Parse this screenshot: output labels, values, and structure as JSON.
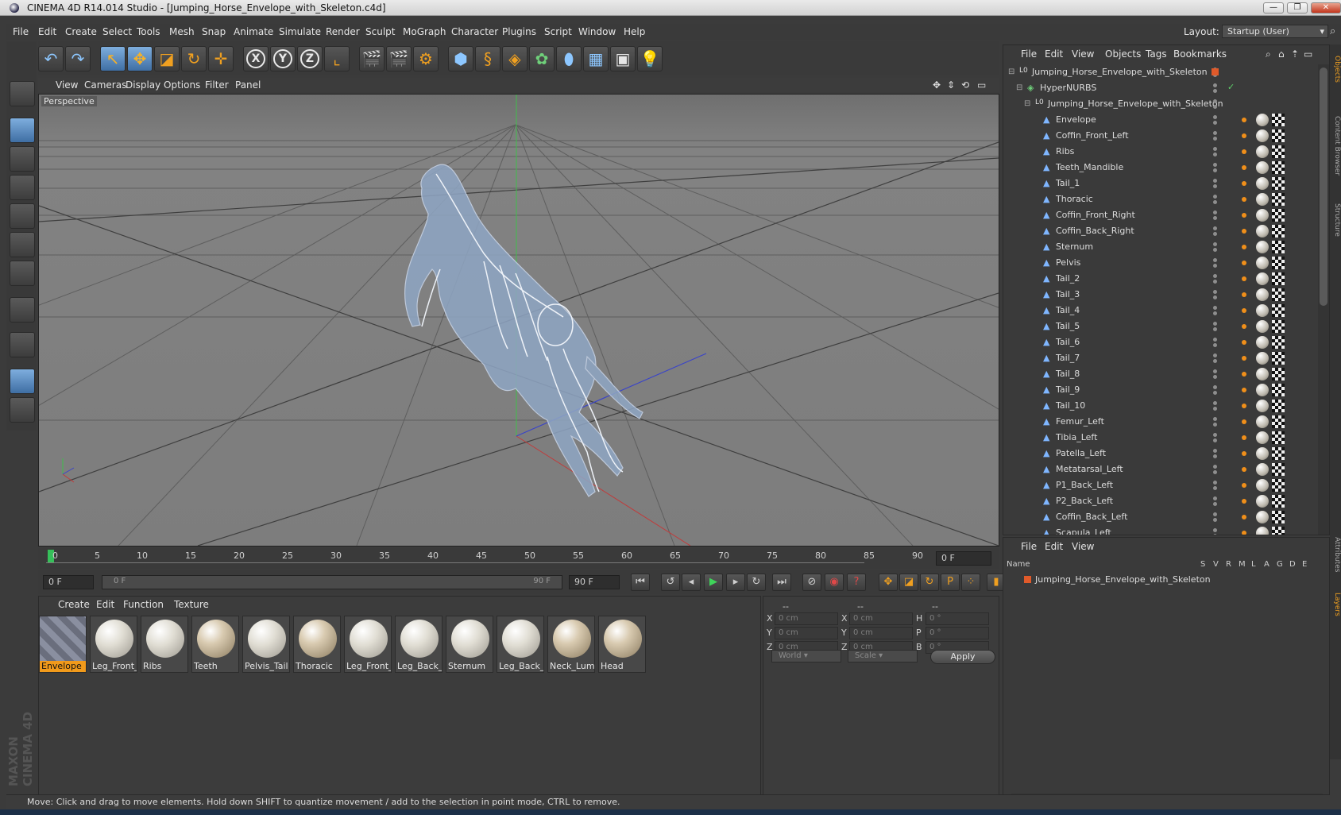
{
  "window": {
    "title": "CINEMA 4D R14.014 Studio - [Jumping_Horse_Envelope_with_Skeleton.c4d]",
    "min": "—",
    "max": "❐",
    "close": "✕"
  },
  "menubar": {
    "items": [
      "File",
      "Edit",
      "Create",
      "Select",
      "Tools",
      "Mesh",
      "Snap",
      "Animate",
      "Simulate",
      "Render",
      "Sculpt",
      "MoGraph",
      "Character",
      "Plugins",
      "Script",
      "Window",
      "Help"
    ],
    "layout_label": "Layout:",
    "layout_value": "Startup (User)"
  },
  "viewport": {
    "menu": [
      "View",
      "Cameras",
      "Display",
      "Options",
      "Filter",
      "Panel"
    ],
    "label": "Perspective"
  },
  "timeline": {
    "ticks": [
      "0",
      "5",
      "10",
      "15",
      "20",
      "25",
      "30",
      "35",
      "40",
      "45",
      "50",
      "55",
      "60",
      "65",
      "70",
      "75",
      "80",
      "85",
      "90"
    ],
    "current_frame": "0 F",
    "start_field": "0 F",
    "range_start": "0 F",
    "range_end": "90 F",
    "end_field": "90 F"
  },
  "materials": {
    "menu": [
      "Create",
      "Edit",
      "Function",
      "Texture"
    ],
    "items": [
      {
        "label": "Envelope",
        "kind": "hatch",
        "selected": true
      },
      {
        "label": "Leg_Front_",
        "kind": "plain"
      },
      {
        "label": "Ribs",
        "kind": "plain"
      },
      {
        "label": "Teeth",
        "kind": "speckle"
      },
      {
        "label": "Pelvis_Tail",
        "kind": "plain"
      },
      {
        "label": "Thoracic",
        "kind": "speckle"
      },
      {
        "label": "Leg_Front_",
        "kind": "plain"
      },
      {
        "label": "Leg_Back_F",
        "kind": "plain"
      },
      {
        "label": "Sternum",
        "kind": "plain"
      },
      {
        "label": "Leg_Back_L",
        "kind": "plain"
      },
      {
        "label": "Neck_Lumb",
        "kind": "speckle"
      },
      {
        "label": "Head",
        "kind": "speckle"
      }
    ]
  },
  "coords": {
    "header": [
      "--",
      "--",
      "--"
    ],
    "rows": [
      {
        "a": "X",
        "va": "0 cm",
        "b": "X",
        "vb": "0 cm",
        "c": "H",
        "vc": "0 °"
      },
      {
        "a": "Y",
        "va": "0 cm",
        "b": "Y",
        "vb": "0 cm",
        "c": "P",
        "vc": "0 °"
      },
      {
        "a": "Z",
        "va": "0 cm",
        "b": "Z",
        "vb": "0 cm",
        "c": "B",
        "vc": "0 °"
      }
    ],
    "space": "World",
    "mode": "Scale",
    "apply": "Apply"
  },
  "objects": {
    "menu": [
      "File",
      "Edit",
      "View",
      "Objects",
      "Tags",
      "Bookmarks"
    ],
    "tree": [
      {
        "name": "Jumping_Horse_Envelope_with_Skeleton",
        "level": 0,
        "kind": "null"
      },
      {
        "name": "HyperNURBS",
        "level": 1,
        "kind": "nurbs"
      },
      {
        "name": "Jumping_Horse_Envelope_with_Skeleton",
        "level": 2,
        "kind": "null"
      },
      {
        "name": "Envelope",
        "level": 3,
        "kind": "mesh"
      },
      {
        "name": "Coffin_Front_Left",
        "level": 3,
        "kind": "mesh"
      },
      {
        "name": "Ribs",
        "level": 3,
        "kind": "mesh"
      },
      {
        "name": "Teeth_Mandible",
        "level": 3,
        "kind": "mesh"
      },
      {
        "name": "Tail_1",
        "level": 3,
        "kind": "mesh"
      },
      {
        "name": "Thoracic",
        "level": 3,
        "kind": "mesh"
      },
      {
        "name": "Coffin_Front_Right",
        "level": 3,
        "kind": "mesh"
      },
      {
        "name": "Coffin_Back_Right",
        "level": 3,
        "kind": "mesh"
      },
      {
        "name": "Sternum",
        "level": 3,
        "kind": "mesh"
      },
      {
        "name": "Pelvis",
        "level": 3,
        "kind": "mesh"
      },
      {
        "name": "Tail_2",
        "level": 3,
        "kind": "mesh"
      },
      {
        "name": "Tail_3",
        "level": 3,
        "kind": "mesh"
      },
      {
        "name": "Tail_4",
        "level": 3,
        "kind": "mesh"
      },
      {
        "name": "Tail_5",
        "level": 3,
        "kind": "mesh"
      },
      {
        "name": "Tail_6",
        "level": 3,
        "kind": "mesh"
      },
      {
        "name": "Tail_7",
        "level": 3,
        "kind": "mesh"
      },
      {
        "name": "Tail_8",
        "level": 3,
        "kind": "mesh"
      },
      {
        "name": "Tail_9",
        "level": 3,
        "kind": "mesh"
      },
      {
        "name": "Tail_10",
        "level": 3,
        "kind": "mesh"
      },
      {
        "name": "Femur_Left",
        "level": 3,
        "kind": "mesh"
      },
      {
        "name": "Tibia_Left",
        "level": 3,
        "kind": "mesh"
      },
      {
        "name": "Patella_Left",
        "level": 3,
        "kind": "mesh"
      },
      {
        "name": "Metatarsal_Left",
        "level": 3,
        "kind": "mesh"
      },
      {
        "name": "P1_Back_Left",
        "level": 3,
        "kind": "mesh"
      },
      {
        "name": "P2_Back_Left",
        "level": 3,
        "kind": "mesh"
      },
      {
        "name": "Coffin_Back_Left",
        "level": 3,
        "kind": "mesh"
      },
      {
        "name": "Scapula_Left",
        "level": 3,
        "kind": "mesh"
      }
    ]
  },
  "layers": {
    "menu": [
      "File",
      "Edit",
      "View"
    ],
    "columns": [
      "Name",
      "S",
      "V",
      "R",
      "M",
      "L",
      "A",
      "G",
      "D",
      "E"
    ],
    "rows": [
      "Jumping_Horse_Envelope_with_Skeleton"
    ]
  },
  "right_tabs": [
    "Objects",
    "Content Browser",
    "Structure",
    "Attributes",
    "Layers"
  ],
  "statusbar": "Move: Click and drag to move elements. Hold down SHIFT to quantize movement / add to the selection in point mode, CTRL to remove.",
  "logo": "MAXON CINEMA 4D",
  "colors": {
    "accent": "#f19a1b",
    "selection": "#5a8fc8"
  }
}
